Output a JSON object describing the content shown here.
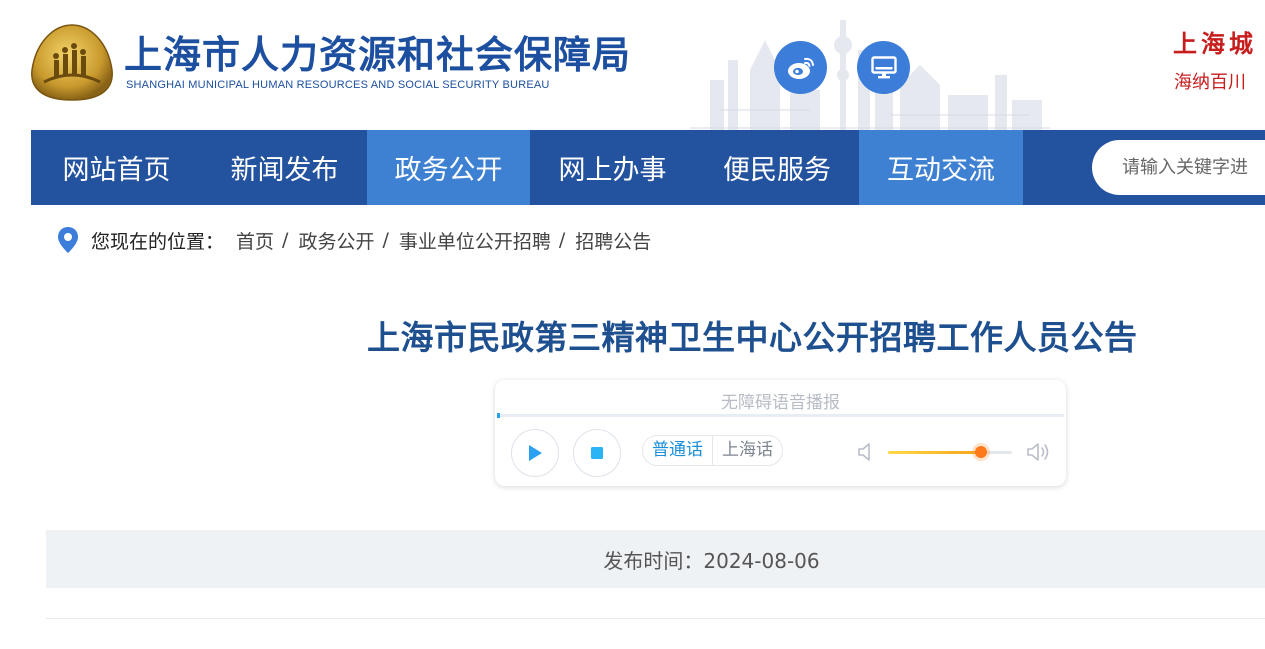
{
  "header": {
    "org_name": "上海市人力资源和社会保障局",
    "org_name_en": "SHANGHAI MUNICIPAL HUMAN RESOURCES AND SOCIAL SECURITY BUREAU",
    "weibo_icon": "weibo-icon",
    "pc_icon": "desktop-monitor-icon",
    "slogan_line1": "上海城",
    "slogan_line2": "海纳百川",
    "colors": {
      "brand_blue": "#1d4fa0",
      "slogan_red": "#c71d1d",
      "icon_blue": "#3b7dd8"
    }
  },
  "nav": {
    "items": [
      {
        "label": "网站首页",
        "active": false
      },
      {
        "label": "新闻发布",
        "active": false
      },
      {
        "label": "政务公开",
        "active": true
      },
      {
        "label": "网上办事",
        "active": false
      },
      {
        "label": "便民服务",
        "active": false
      },
      {
        "label": "互动交流",
        "active": true
      }
    ],
    "search_placeholder": "请输入关键字进",
    "colors": {
      "bar": "#23529f",
      "active": "#3e80d1"
    }
  },
  "breadcrumb": {
    "icon": "location-pin-icon",
    "label": "您现在的位置：",
    "items": [
      "首页",
      "政务公开",
      "事业单位公开招聘",
      "招聘公告"
    ],
    "separator": "/"
  },
  "article": {
    "title": "上海市民政第三精神卫生中心公开招聘工作人员公告",
    "publish_label": "发布时间：",
    "publish_date": "2024-08-06",
    "publish_text": "发布时间：2024-08-06"
  },
  "player": {
    "title": "无障碍语音播报",
    "play_icon": "play-icon",
    "stop_icon": "stop-icon",
    "languages": [
      {
        "label": "普通话",
        "selected": true
      },
      {
        "label": "上海话",
        "selected": false
      }
    ],
    "volume_low_icon": "volume-low-icon",
    "volume_high_icon": "volume-high-icon",
    "volume_level": 0.75,
    "progress": 0.0
  }
}
